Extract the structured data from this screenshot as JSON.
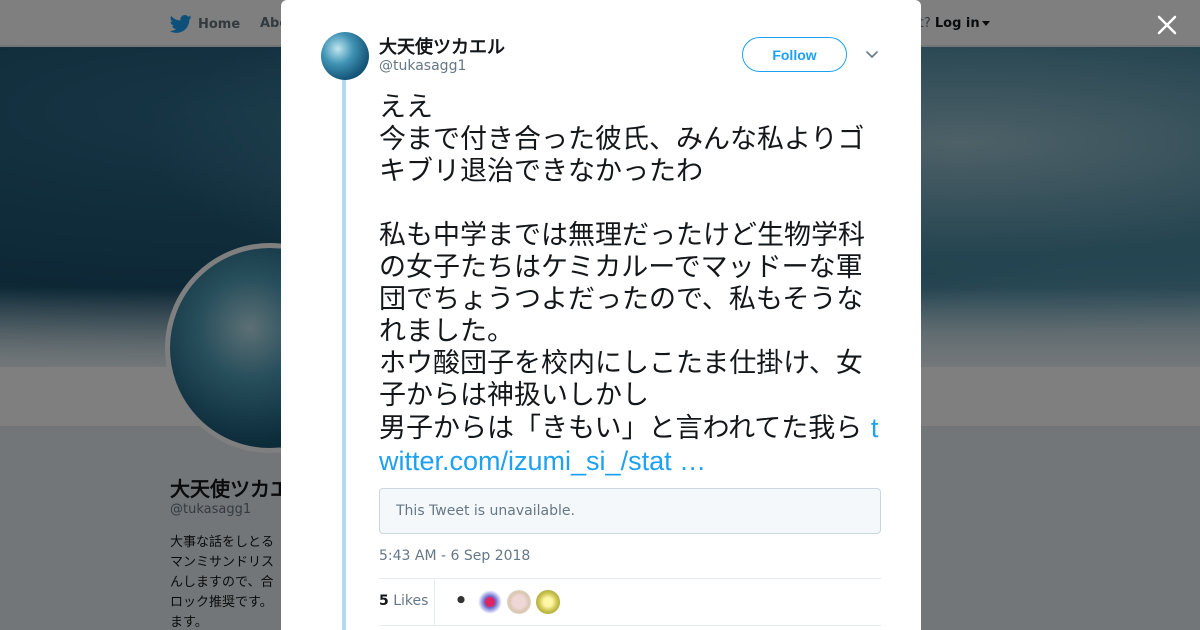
{
  "nav": {
    "home_label": "Home",
    "about_label": "Abo",
    "account_prompt": "ccount?",
    "login_label": "Log in"
  },
  "background_profile": {
    "name": "大天使ツカエ",
    "handle": "@tukasagg1",
    "bio": "大事な話をしとるマンミサンドリスんしますので、合ロック推奨です。ます。"
  },
  "tweet": {
    "author_name": "大天使ツカエル",
    "author_handle": "@tukasagg1",
    "follow_label": "Follow",
    "text": "ええ\n今まで付き合った彼氏、みんな私よりゴキブリ退治できなかったわ\n\n私も中学までは無理だったけど生物学科の女子たちはケミカルーでマッドーな軍団でちょうつよだったので、私もそうなれました。\nホウ酸団子を校内にしこたま仕掛け、女子からは神扱いしかし\n男子からは「きもい」と言われてた我ら ",
    "link_text": "twitter.com/izumi_si_/stat …",
    "quoted_unavailable": "This Tweet is unavailable.",
    "timestamp": "5:43 AM - 6 Sep 2018",
    "likes_count": "5",
    "likes_label": "Likes"
  },
  "colors": {
    "accent": "#1da1f2",
    "thread_line": "#b3d9f0"
  },
  "icons": [
    "twitter-bird-icon",
    "close-icon",
    "chevron-down-icon"
  ]
}
